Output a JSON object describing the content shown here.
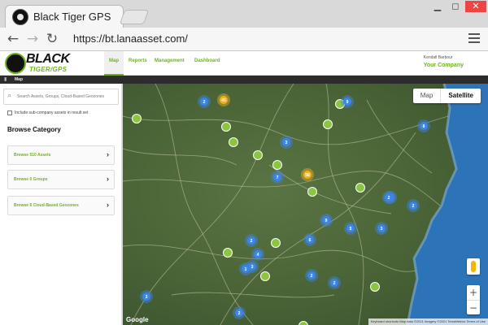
{
  "browser": {
    "tab_title": "Black Tiger GPS",
    "url": "https://bt.lanaasset.com/",
    "win_min": "▁",
    "win_max": "◻",
    "win_close": "✕",
    "back": "←",
    "forward": "→",
    "reload": "↻"
  },
  "app": {
    "brand_top": "BLACK",
    "brand_bottom": "TIGER/GPS",
    "nav": [
      "Map",
      "Reports",
      "Management",
      "Dashboard"
    ],
    "active_nav": "Map",
    "user_name": "Kendall Barbour",
    "company": "Your Company",
    "breadcrumb": "Map"
  },
  "sidebar": {
    "search_placeholder": "Search Assets, Groups, Cloud-Based Geozones",
    "include_sub_label": "Include sub-company assets in result set",
    "browse_title": "Browse Category",
    "items": [
      {
        "label": "Browse 510 Assets"
      },
      {
        "label": "Browse 0 Groups"
      },
      {
        "label": "Browse 6 Cloud-Based Geozones"
      }
    ]
  },
  "map": {
    "type_map": "Map",
    "type_satellite": "Satellite",
    "active_type": "Satellite",
    "zoom_in": "+",
    "zoom_out": "−",
    "google": "Google",
    "attribution": "Keyboard shortcuts   Map data ©2021 Imagery ©2021 TerraMetrics   Terms of Use",
    "colors": {
      "land": "#4a6437",
      "ocean": "#2d73b8",
      "road": "#c9c9b0",
      "green_marker": "#8cc63f",
      "blue_cluster": "#3b86e8",
      "orange_cluster": "#f2b01e"
    },
    "clusters": [
      {
        "label": "2",
        "color": "blue"
      },
      {
        "label": "45",
        "color": "orange"
      },
      {
        "label": "9",
        "color": "blue"
      },
      {
        "label": "8",
        "color": "blue"
      },
      {
        "label": "3",
        "color": "blue"
      },
      {
        "label": "58",
        "color": "orange"
      },
      {
        "label": "7",
        "color": "blue"
      },
      {
        "label": "3",
        "color": "blue"
      },
      {
        "label": "2",
        "color": "blue"
      },
      {
        "label": "9",
        "color": "blue"
      },
      {
        "label": "5",
        "color": "blue"
      },
      {
        "label": "3",
        "color": "blue"
      },
      {
        "label": "6",
        "color": "blue"
      },
      {
        "label": "2",
        "color": "blue"
      },
      {
        "label": "4",
        "color": "blue"
      },
      {
        "label": "2",
        "color": "blue"
      },
      {
        "label": "3",
        "color": "blue"
      },
      {
        "label": "2",
        "color": "blue"
      },
      {
        "label": "3",
        "color": "blue"
      },
      {
        "label": "2",
        "color": "blue"
      },
      {
        "label": "3",
        "color": "blue"
      },
      {
        "label": "2",
        "color": "blue"
      }
    ]
  }
}
